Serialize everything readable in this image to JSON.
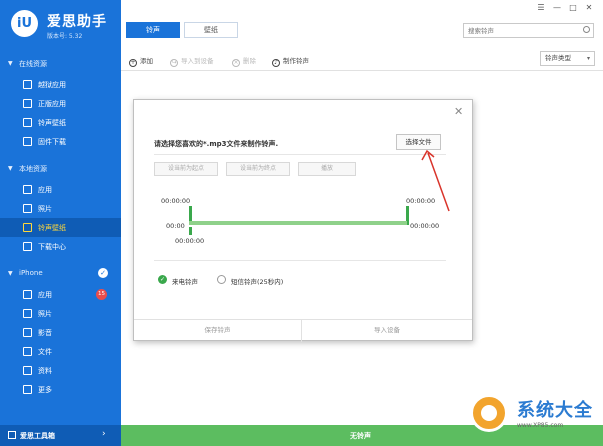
{
  "app": {
    "name": "爱思助手",
    "version": "版本号: 5.32",
    "logo_text": "iU"
  },
  "window_controls": [
    "☰",
    "—",
    "□",
    "✕"
  ],
  "sidebar": {
    "online_section": "在线资源",
    "online_items": [
      {
        "label": "越狱应用",
        "icon": "app-box-icon"
      },
      {
        "label": "正版应用",
        "icon": "app-grid-icon"
      },
      {
        "label": "铃声壁纸",
        "icon": "ringtone-icon"
      },
      {
        "label": "固件下载",
        "icon": "firmware-icon"
      }
    ],
    "local_section": "本地资源",
    "local_items": [
      {
        "label": "应用",
        "icon": "app-grid-icon"
      },
      {
        "label": "照片",
        "icon": "photo-icon"
      },
      {
        "label": "铃声壁纸",
        "icon": "ringtone-icon",
        "active": true
      },
      {
        "label": "下载中心",
        "icon": "download-icon"
      }
    ],
    "device_section": "iPhone",
    "device_items": [
      {
        "label": "应用",
        "icon": "app-grid-icon",
        "badge": "15"
      },
      {
        "label": "照片",
        "icon": "photo-icon"
      },
      {
        "label": "影音",
        "icon": "music-icon"
      },
      {
        "label": "文件",
        "icon": "folder-icon"
      },
      {
        "label": "资料",
        "icon": "contacts-icon"
      },
      {
        "label": "更多",
        "icon": "more-icon"
      }
    ],
    "footer_label": "爱思工具箱"
  },
  "tabs": [
    {
      "label": "铃声",
      "active": true
    },
    {
      "label": "壁纸",
      "active": false
    }
  ],
  "search": {
    "placeholder": "搜索铃声"
  },
  "toolbar": {
    "add": "添加",
    "import_device": "导入到设备",
    "delete": "删除",
    "make_ringtone": "制作铃声",
    "type_select": "铃声类型"
  },
  "dialog": {
    "prompt": "请选择您喜欢的*.mp3文件来制作铃声.",
    "choose_file": "选择文件",
    "set_start": "设当前为起点",
    "set_end": "设当前为终点",
    "play": "播放",
    "time_start_top": "00:00:00",
    "time_end_top": "00:00:00",
    "time_left_mid": "00:00",
    "time_right_mid": "00:00:00",
    "time_start_bottom": "00:00:00",
    "option_call": "来电铃声",
    "option_sms": "短信铃声(25秒内)",
    "save": "保存铃声",
    "import": "导入设备"
  },
  "status": {
    "text": "无铃声"
  },
  "watermark": {
    "title": "系统大全",
    "url": "www.XP85.com"
  },
  "colors": {
    "sidebar": "#1a73d9",
    "sidebar_active": "#0f5cb5",
    "active_text": "#ffd83a",
    "status_green": "#5cbd60",
    "timeline": "#8fd18a",
    "annotation": "#d9342b"
  }
}
